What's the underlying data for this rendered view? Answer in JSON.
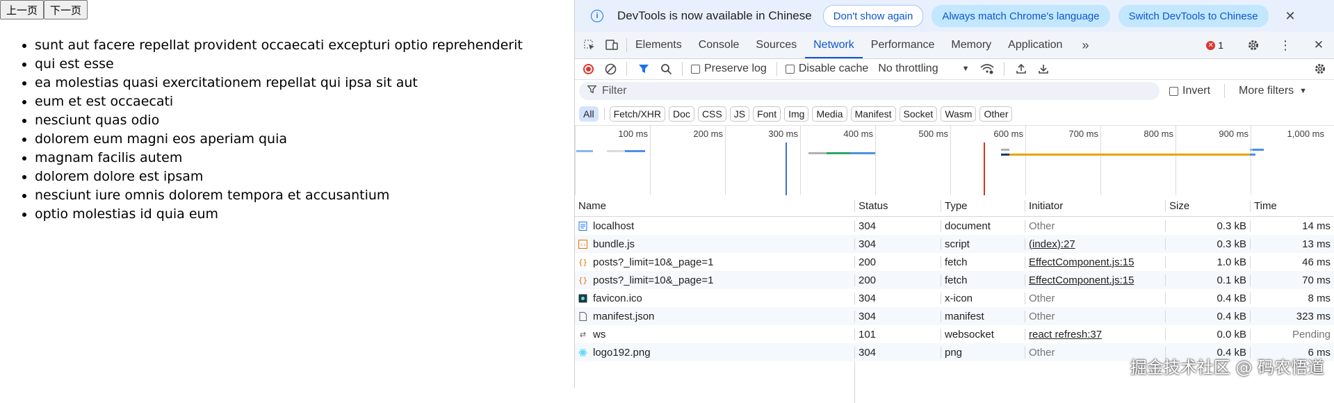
{
  "pager": {
    "prev": "上一页",
    "next": "下一页"
  },
  "posts": [
    "sunt aut facere repellat provident occaecati excepturi optio reprehenderit",
    "qui est esse",
    "ea molestias quasi exercitationem repellat qui ipsa sit aut",
    "eum et est occaecati",
    "nesciunt quas odio",
    "dolorem eum magni eos aperiam quia",
    "magnam facilis autem",
    "dolorem dolore est ipsam",
    "nesciunt iure omnis dolorem tempora et accusantium",
    "optio molestias id quia eum"
  ],
  "infobar": {
    "text": "DevTools is now available in Chinese",
    "dont_show": "Don't show again",
    "always_match": "Always match Chrome's language",
    "switch": "Switch DevTools to Chinese",
    "close": "✕"
  },
  "tabs": [
    "Elements",
    "Console",
    "Sources",
    "Network",
    "Performance",
    "Memory",
    "Application"
  ],
  "active_tab": "Network",
  "error_count": "1",
  "toolbar": {
    "preserve_log": "Preserve log",
    "disable_cache": "Disable cache",
    "throttling": "No throttling"
  },
  "filter": {
    "placeholder": "Filter",
    "invert": "Invert",
    "more_filters": "More filters"
  },
  "chips": [
    "All",
    "Fetch/XHR",
    "Doc",
    "CSS",
    "JS",
    "Font",
    "Img",
    "Media",
    "Manifest",
    "Socket",
    "Wasm",
    "Other"
  ],
  "ticks": [
    "100 ms",
    "200 ms",
    "300 ms",
    "400 ms",
    "500 ms",
    "600 ms",
    "700 ms",
    "800 ms",
    "900 ms",
    "1,000 ms"
  ],
  "columns": {
    "name": "Name",
    "status": "Status",
    "type": "Type",
    "initiator": "Initiator",
    "size": "Size",
    "time": "Time"
  },
  "requests": [
    {
      "name": "localhost",
      "status": "304",
      "type": "document",
      "initiator": "Other",
      "size": "0.3 kB",
      "time": "14 ms",
      "icon": "document-icon"
    },
    {
      "name": "bundle.js",
      "status": "304",
      "type": "script",
      "initiator": "(index):27",
      "size": "0.3 kB",
      "time": "13 ms",
      "icon": "script-icon"
    },
    {
      "name": "posts?_limit=10&_page=1",
      "status": "200",
      "type": "fetch",
      "initiator": "EffectComponent.js:15",
      "size": "1.0 kB",
      "time": "46 ms",
      "icon": "fetch-icon"
    },
    {
      "name": "posts?_limit=10&_page=1",
      "status": "200",
      "type": "fetch",
      "initiator": "EffectComponent.js:15",
      "size": "0.1 kB",
      "time": "70 ms",
      "icon": "fetch-icon"
    },
    {
      "name": "favicon.ico",
      "status": "304",
      "type": "x-icon",
      "initiator": "Other",
      "size": "0.4 kB",
      "time": "8 ms",
      "icon": "favicon-icon"
    },
    {
      "name": "manifest.json",
      "status": "304",
      "type": "manifest",
      "initiator": "Other",
      "size": "0.4 kB",
      "time": "323 ms",
      "icon": "manifest-icon"
    },
    {
      "name": "ws",
      "status": "101",
      "type": "websocket",
      "initiator": "react refresh:37",
      "size": "0.0 kB",
      "time": "Pending",
      "icon": "websocket-icon"
    },
    {
      "name": "logo192.png",
      "status": "304",
      "type": "png",
      "initiator": "Other",
      "size": "0.4 kB",
      "time": "6 ms",
      "icon": "image-icon"
    }
  ],
  "watermark": "掘金技术社区 @ 码农悟道"
}
